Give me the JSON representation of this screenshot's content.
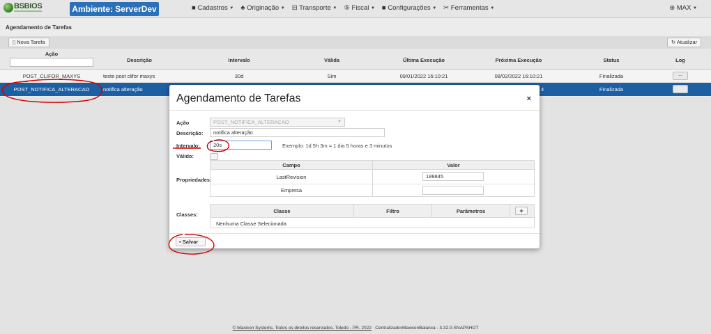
{
  "header": {
    "logo_text": "BSBIOS",
    "environment": "Ambiente: ServerDev",
    "menu": [
      {
        "icon": "grid-icon",
        "glyph": "■",
        "label": "Cadastros"
      },
      {
        "icon": "plant-icon",
        "glyph": "♣",
        "label": "Originação"
      },
      {
        "icon": "truck-icon",
        "glyph": "⊟",
        "label": "Transporte"
      },
      {
        "icon": "fiscal-icon",
        "glyph": "⑤",
        "label": "Fiscal"
      },
      {
        "icon": "settings-icon",
        "glyph": "■",
        "label": "Configurações"
      },
      {
        "icon": "tools-icon",
        "glyph": "✂",
        "label": "Ferramentas"
      }
    ],
    "user": "MAX"
  },
  "page": {
    "title": "Agendamento de Tarefas",
    "new_task_label": "Nova Tarefa",
    "refresh_label": "Atualizar"
  },
  "table": {
    "headers": {
      "acao": "Ação",
      "descricao": "Descrição",
      "intervalo": "Intervalo",
      "valida": "Válida",
      "ultima": "Última Execução",
      "proxima": "Próxima Execução",
      "status": "Status",
      "log": "Log"
    },
    "rows": [
      {
        "acao": "POST_CLIFOR_MAXYS",
        "descricao": "teste post clifor maxys",
        "intervalo": "30d",
        "valida": "Sim",
        "ultima": "09/01/2022 16:10:21",
        "proxima": "08/02/2022 16:10:21",
        "status": "Finalizada",
        "log": "..."
      },
      {
        "acao": "POST_NOTIFICA_ALTERACAO",
        "descricao": "notifica alteração",
        "status": "Finalizada",
        "proxima_tail": "4",
        "log": "..."
      }
    ]
  },
  "modal": {
    "title": "Agendamento de Tarefas",
    "close": "×",
    "labels": {
      "acao": "Ação",
      "descricao": "Descrição:",
      "intervalo": "Intervalo:",
      "valido": "Válido:",
      "propriedades": "Propriedades:",
      "classes": "Classes:"
    },
    "acao_value": "POST_NOTIFICA_ALTERACAO",
    "descricao_value": "notifica alteração",
    "intervalo_value": "20s",
    "intervalo_hint": "Exemplo: 1d 5h 3m = 1 dia 5 horas e 3 minutos",
    "props_headers": {
      "campo": "Campo",
      "valor": "Valor"
    },
    "props_rows": [
      {
        "campo": "LastRevision",
        "valor": "188845"
      },
      {
        "campo": "Empresa",
        "valor": ""
      }
    ],
    "classes_headers": {
      "classe": "Classe",
      "filtro": "Filtro",
      "parametros": "Parâmetros",
      "add": "+"
    },
    "classes_empty": "Nenhuma Classe Selecionada",
    "save_label": "Salvar"
  },
  "footer": {
    "copyright": "© Maxicon Systems. Todos os direitos reservados. Toledo - PR. 2022",
    "version": "CentralizadorMaxiconBalanca - 3.32.0-SNAPSHOT"
  },
  "colors": {
    "navbar_bg": "#e6e6e6",
    "env_badge": "#2b70b8",
    "selected_row": "#1d5fa3",
    "annotation_red": "#d40000"
  }
}
